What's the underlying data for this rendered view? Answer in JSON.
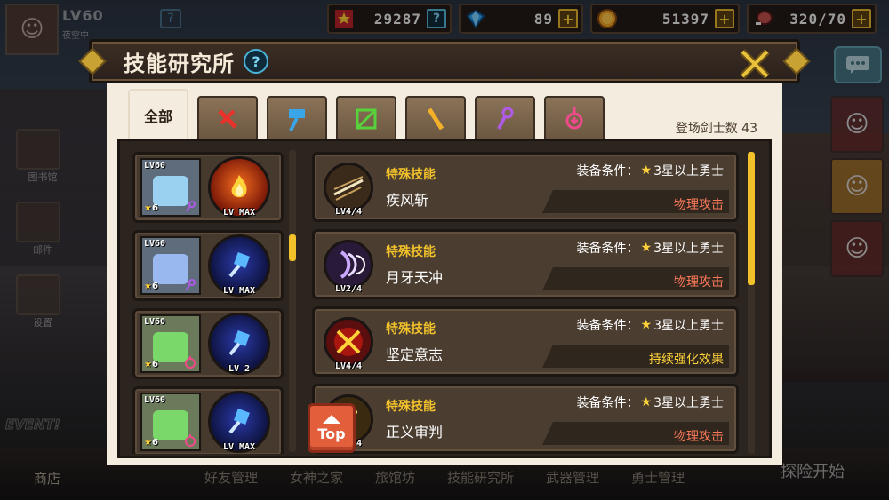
{
  "player": {
    "level": "LV60",
    "name": "夜空中",
    "help": "?"
  },
  "resources": [
    {
      "icon": "medal-icon",
      "value": "29287",
      "action": "?"
    },
    {
      "icon": "gem-icon",
      "value": "89",
      "action": "+"
    },
    {
      "icon": "gold-coin-icon",
      "value": "51397",
      "action": "+"
    },
    {
      "icon": "meat-icon",
      "value": "320/70",
      "action": "+"
    }
  ],
  "title": {
    "text": "技能研究所",
    "help": "?"
  },
  "tabs": [
    {
      "label": "全部",
      "active": true
    },
    {
      "icon": "sword-icon",
      "color": "#e8322a"
    },
    {
      "icon": "hammer-icon",
      "color": "#3aa6e8"
    },
    {
      "icon": "bow-icon",
      "color": "#58d23a"
    },
    {
      "icon": "staff-icon",
      "color": "#f3b02b"
    },
    {
      "icon": "wand-icon",
      "color": "#b05ae8"
    },
    {
      "icon": "holy-symbol-icon",
      "color": "#f04a8a"
    }
  ],
  "hero_count_label": "登场剑士数 43",
  "heroes": [
    {
      "level": "LV60",
      "stars": "6",
      "skill_level": "LV MAX",
      "orb": "fire",
      "face": "#9ad0f0"
    },
    {
      "level": "LV60",
      "stars": "6",
      "skill_level": "LV MAX",
      "orb": "blue",
      "face": "#9ab8f0"
    },
    {
      "level": "LV60",
      "stars": "6",
      "skill_level": "LV 2",
      "orb": "blue",
      "face": "#7ad86a"
    },
    {
      "level": "LV60",
      "stars": "6",
      "skill_level": "LV MAX",
      "orb": "blue",
      "face": "#7ad86a"
    }
  ],
  "skills": [
    {
      "type": "特殊技能",
      "name": "疾风斩",
      "level": "LV4/4",
      "req_prefix": "装备条件：",
      "req": "3星以上勇士",
      "tag": "物理攻击",
      "tag_color": "red",
      "icon": "wind-slash-icon"
    },
    {
      "type": "特殊技能",
      "name": "月牙天冲",
      "level": "LV2/4",
      "req_prefix": "装备条件：",
      "req": "3星以上勇士",
      "tag": "物理攻击",
      "tag_color": "red",
      "icon": "crescent-icon"
    },
    {
      "type": "特殊技能",
      "name": "坚定意志",
      "level": "LV4/4",
      "req_prefix": "装备条件：",
      "req": "3星以上勇士",
      "tag": "持续强化效果",
      "tag_color": "yellow",
      "icon": "crossed-swords-icon"
    },
    {
      "type": "特殊技能",
      "name": "正义审判",
      "level": "LV4/4",
      "req_prefix": "装备条件：",
      "req": "3星以上勇士",
      "tag": "物理攻击",
      "tag_color": "red",
      "icon": "judgement-icon"
    }
  ],
  "top_button": "Top",
  "background": {
    "left_labels": [
      "图书馆",
      "邮件",
      "设置"
    ],
    "event": "EVENT!",
    "store": "商店",
    "bottom_nav": [
      "好友管理",
      "女神之家",
      "旅馆坊",
      "技能研究所",
      "武器管理",
      "勇士管理"
    ],
    "explore": "探险开始",
    "side_label": "商品"
  }
}
